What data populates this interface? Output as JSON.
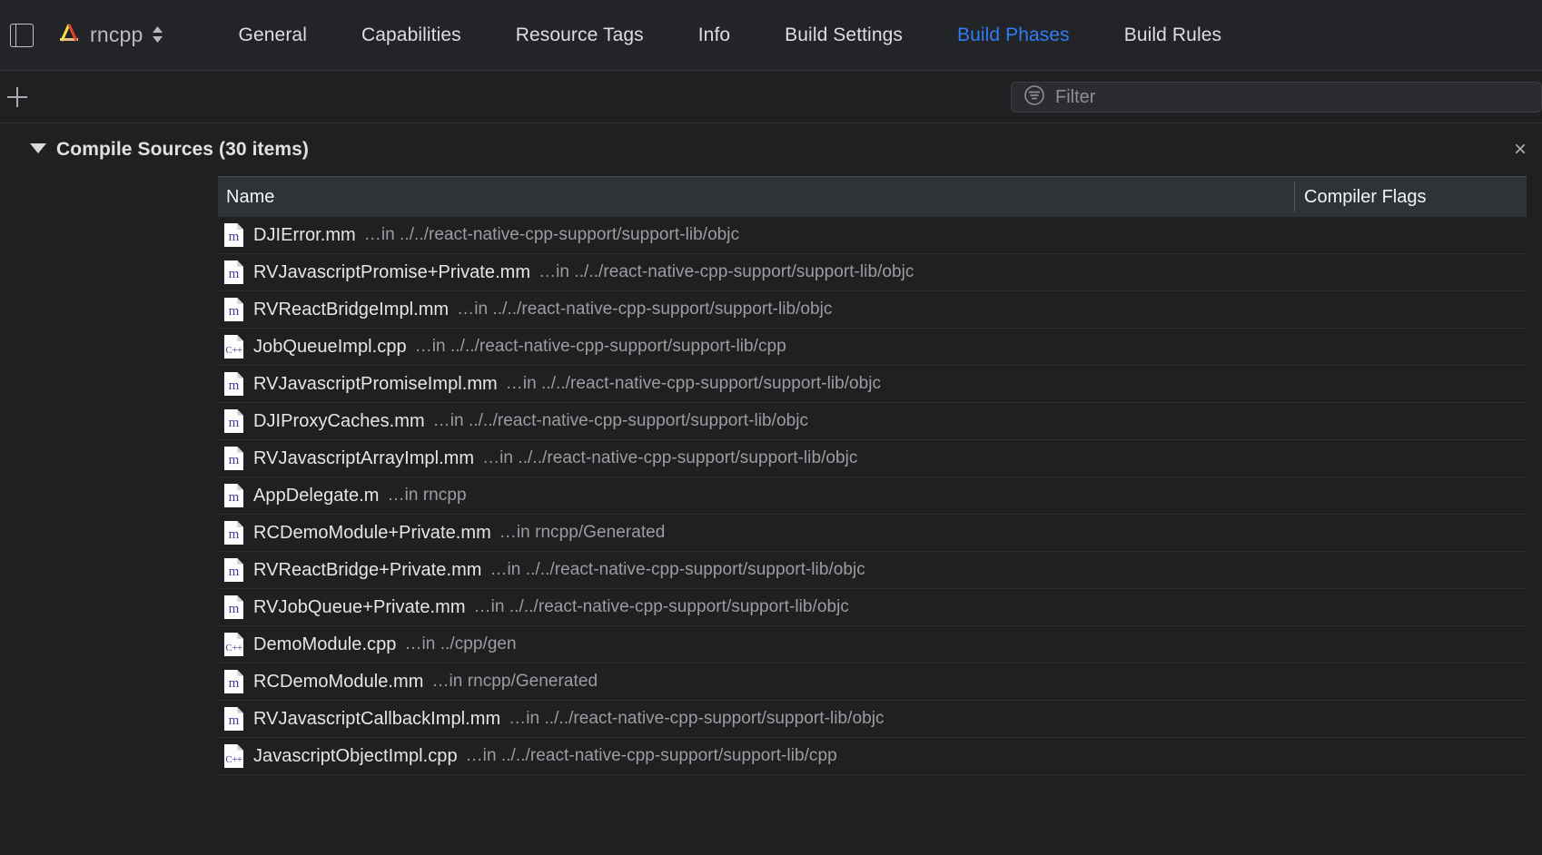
{
  "titlebar": {
    "sidebar_toggle_icon": "sidebar-left-icon",
    "scheme_icon": "xcode-project-icon",
    "scheme_name": "rncpp",
    "stepper_icon": "chevron-up-down-icon"
  },
  "tabs": [
    {
      "label": "General",
      "active": false
    },
    {
      "label": "Capabilities",
      "active": false
    },
    {
      "label": "Resource Tags",
      "active": false
    },
    {
      "label": "Info",
      "active": false
    },
    {
      "label": "Build Settings",
      "active": false
    },
    {
      "label": "Build Phases",
      "active": true
    },
    {
      "label": "Build Rules",
      "active": false
    }
  ],
  "toolbar": {
    "add_icon": "plus-icon",
    "filter_icon": "filter-icon",
    "filter_placeholder": "Filter",
    "filter_value": ""
  },
  "phase": {
    "disclosure_icon": "disclosure-triangle-down-icon",
    "title": "Compile Sources (30 items)",
    "close_icon": "close-icon",
    "close_glyph": "×"
  },
  "table": {
    "columns": [
      "Name",
      "Compiler Flags"
    ],
    "rows": [
      {
        "icon": "mm",
        "icon_badge": "m",
        "name": "DJIError.mm",
        "path": "…in ../../react-native-cpp-support/support-lib/objc",
        "flags": ""
      },
      {
        "icon": "mm",
        "icon_badge": "m",
        "name": "RVJavascriptPromise+Private.mm",
        "path": "…in ../../react-native-cpp-support/support-lib/objc",
        "flags": ""
      },
      {
        "icon": "mm",
        "icon_badge": "m",
        "name": "RVReactBridgeImpl.mm",
        "path": "…in ../../react-native-cpp-support/support-lib/objc",
        "flags": ""
      },
      {
        "icon": "cpp",
        "icon_badge": "C++",
        "name": "JobQueueImpl.cpp",
        "path": "…in ../../react-native-cpp-support/support-lib/cpp",
        "flags": ""
      },
      {
        "icon": "mm",
        "icon_badge": "m",
        "name": "RVJavascriptPromiseImpl.mm",
        "path": "…in ../../react-native-cpp-support/support-lib/objc",
        "flags": ""
      },
      {
        "icon": "mm",
        "icon_badge": "m",
        "name": "DJIProxyCaches.mm",
        "path": "…in ../../react-native-cpp-support/support-lib/objc",
        "flags": ""
      },
      {
        "icon": "mm",
        "icon_badge": "m",
        "name": "RVJavascriptArrayImpl.mm",
        "path": "…in ../../react-native-cpp-support/support-lib/objc",
        "flags": ""
      },
      {
        "icon": "mm",
        "icon_badge": "m",
        "name": "AppDelegate.m",
        "path": "…in rncpp",
        "flags": ""
      },
      {
        "icon": "mm",
        "icon_badge": "m",
        "name": "RCDemoModule+Private.mm",
        "path": "…in rncpp/Generated",
        "flags": ""
      },
      {
        "icon": "mm",
        "icon_badge": "m",
        "name": "RVReactBridge+Private.mm",
        "path": "…in ../../react-native-cpp-support/support-lib/objc",
        "flags": ""
      },
      {
        "icon": "mm",
        "icon_badge": "m",
        "name": "RVJobQueue+Private.mm",
        "path": "…in ../../react-native-cpp-support/support-lib/objc",
        "flags": ""
      },
      {
        "icon": "cpp",
        "icon_badge": "C++",
        "name": "DemoModule.cpp",
        "path": "…in ../cpp/gen",
        "flags": ""
      },
      {
        "icon": "mm",
        "icon_badge": "m",
        "name": "RCDemoModule.mm",
        "path": "…in rncpp/Generated",
        "flags": ""
      },
      {
        "icon": "mm",
        "icon_badge": "m",
        "name": "RVJavascriptCallbackImpl.mm",
        "path": "…in ../../react-native-cpp-support/support-lib/objc",
        "flags": ""
      },
      {
        "icon": "cpp",
        "icon_badge": "C++",
        "name": "JavascriptObjectImpl.cpp",
        "path": "…in ../../react-native-cpp-support/support-lib/cpp",
        "flags": ""
      }
    ]
  },
  "colors": {
    "accent": "#2f7cf6",
    "background": "#1e2022",
    "header_background": "#222427",
    "table_header": "#303336",
    "icon_badge": "#463b93"
  }
}
